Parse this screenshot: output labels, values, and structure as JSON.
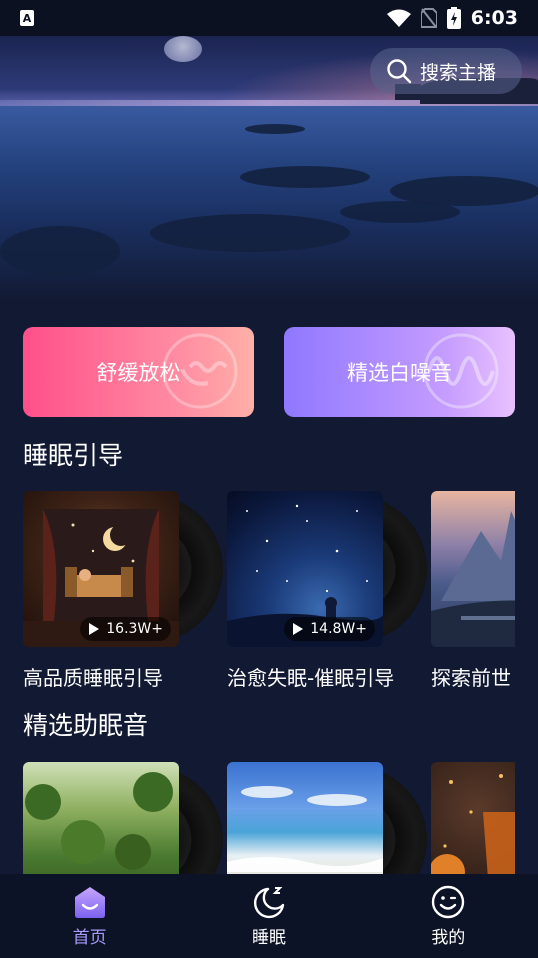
{
  "status_bar": {
    "time": "6:03",
    "app_badge": "A"
  },
  "search": {
    "label": "搜索主播"
  },
  "categories": [
    {
      "label": "舒缓放松",
      "icon": "moon-wave-icon"
    },
    {
      "label": "精选白噪音",
      "icon": "sound-wave-icon"
    }
  ],
  "sleep_guide": {
    "title": "睡眠引导",
    "items": [
      {
        "title": "高品质睡眠引导",
        "plays": "16.3W+"
      },
      {
        "title": "治愈失眠-催眠引导",
        "plays": "14.8W+"
      },
      {
        "title": "探索前世",
        "plays": ""
      }
    ]
  },
  "sleep_sounds": {
    "title": "精选助眠音",
    "items": [
      {
        "title": ""
      },
      {
        "title": ""
      },
      {
        "title": ""
      }
    ]
  },
  "bottom_nav": {
    "items": [
      {
        "label": "首页",
        "icon": "home-icon",
        "active": true
      },
      {
        "label": "睡眠",
        "icon": "moon-icon",
        "active": false
      },
      {
        "label": "我的",
        "icon": "smile-icon",
        "active": false
      }
    ]
  },
  "colors": {
    "background": "#121a33",
    "nav_active": "#a99bff",
    "relax_gradient": [
      "#ff4f8a",
      "#ffb0a8"
    ],
    "noise_gradient": [
      "#8f78ff",
      "#e8c2ff"
    ]
  }
}
